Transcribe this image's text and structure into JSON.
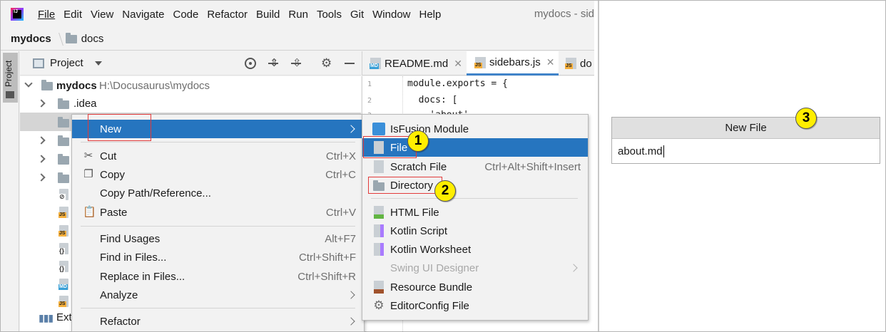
{
  "menubar": {
    "items": [
      "File",
      "Edit",
      "View",
      "Navigate",
      "Code",
      "Refactor",
      "Build",
      "Run",
      "Tools",
      "Git",
      "Window",
      "Help"
    ],
    "window_title": "mydocs - sid"
  },
  "breadcrumb": {
    "root": "mydocs",
    "child": "docs"
  },
  "tool_window": {
    "stripe_label": "Project",
    "title": "Project"
  },
  "tree": {
    "root_label": "mydocs",
    "root_path": "H:\\Docusaurus\\mydocs",
    "idea_label": ".idea",
    "external_partial": "Exte"
  },
  "editor": {
    "tabs": [
      {
        "label": "README.md",
        "badge": "MD"
      },
      {
        "label": "sidebars.js",
        "badge": "JS"
      },
      {
        "label": "do",
        "badge": "JS"
      }
    ],
    "lines": [
      "1",
      "2",
      "3"
    ],
    "code": [
      "module.exports = {",
      "  docs: [",
      "    'about',"
    ]
  },
  "context_menu": {
    "new": "New",
    "cut": "Cut",
    "cut_sc": "Ctrl+X",
    "copy": "Copy",
    "copy_sc": "Ctrl+C",
    "copy_path": "Copy Path/Reference...",
    "paste": "Paste",
    "paste_sc": "Ctrl+V",
    "find_usages": "Find Usages",
    "find_usages_sc": "Alt+F7",
    "find_in_files": "Find in Files...",
    "find_in_files_sc": "Ctrl+Shift+F",
    "replace_in_files": "Replace in Files...",
    "replace_in_files_sc": "Ctrl+Shift+R",
    "analyze": "Analyze",
    "refactor": "Refactor"
  },
  "new_submenu": {
    "isfusion": "IsFusion Module",
    "file": "File",
    "scratch": "Scratch File",
    "scratch_sc": "Ctrl+Alt+Shift+Insert",
    "directory": "Directory",
    "html": "HTML File",
    "kotlin_script": "Kotlin Script",
    "kotlin_worksheet": "Kotlin Worksheet",
    "swing": "Swing UI Designer",
    "resource_bundle": "Resource Bundle",
    "editorconfig": "EditorConfig File"
  },
  "callouts": {
    "one": "1",
    "two": "2",
    "three": "3"
  },
  "dialog": {
    "title": "New File",
    "value": "about.md"
  },
  "colors": {
    "selection": "#2675bf",
    "callout": "#ffee00",
    "highlight_box": "#e23a3a"
  }
}
